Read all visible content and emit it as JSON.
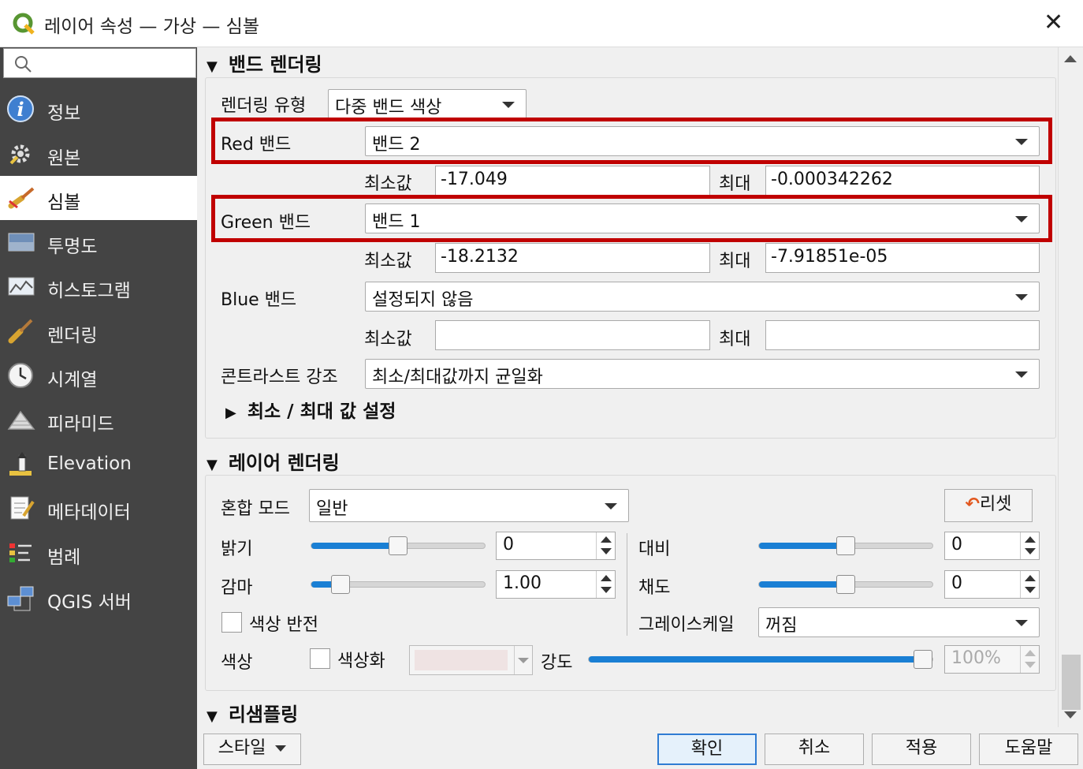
{
  "window": {
    "title": "레이어 속성 — 가상 — 심볼"
  },
  "sidebar": {
    "items": [
      {
        "label": "정보",
        "icon": "info-icon"
      },
      {
        "label": "원본",
        "icon": "source-gear-icon"
      },
      {
        "label": "심볼",
        "icon": "symbology-brush-icon",
        "selected": true
      },
      {
        "label": "투명도",
        "icon": "transparency-icon"
      },
      {
        "label": "히스토그램",
        "icon": "histogram-icon"
      },
      {
        "label": "렌더링",
        "icon": "rendering-brush-icon"
      },
      {
        "label": "시계열",
        "icon": "clock-icon"
      },
      {
        "label": "피라미드",
        "icon": "pyramid-icon"
      },
      {
        "label": "Elevation",
        "icon": "elevation-icon"
      },
      {
        "label": "메타데이터",
        "icon": "metadata-icon"
      },
      {
        "label": "범례",
        "icon": "legend-icon"
      },
      {
        "label": "QGIS 서버",
        "icon": "server-icon"
      }
    ]
  },
  "band": {
    "title": "밴드 렌더링",
    "render_type_label": "렌더링 유형",
    "render_type": "다중 밴드 색상",
    "red_label": "Red 밴드",
    "red_value": "밴드 2",
    "min_label": "최소값",
    "max_label": "최대",
    "red_min": "-17.049",
    "red_max": "-0.000342262",
    "green_label": "Green 밴드",
    "green_value": "밴드 1",
    "green_min": "-18.2132",
    "green_max": "-7.91851e-05",
    "blue_label": "Blue 밴드",
    "blue_value": "설정되지 않음",
    "blue_min": "",
    "blue_max": "",
    "contrast_label": "콘트라스트 강조",
    "contrast_value": "최소/최대값까지 균일화",
    "minmax_title": "최소 / 최대 값 설정"
  },
  "layer": {
    "title": "레이어 렌더링",
    "blend_label": "혼합 모드",
    "blend_value": "일반",
    "reset_label": "리셋",
    "brightness_label": "밝기",
    "brightness_value": "0",
    "brightness_level": 0.5,
    "contrast_label": "대비",
    "contrast_value": "0",
    "contrast_level": 0.5,
    "gamma_label": "감마",
    "gamma_value": "1.00",
    "gamma_level": 0.13,
    "saturation_label": "채도",
    "saturation_value": "0",
    "saturation_level": 0.5,
    "invert_label": "색상 반전",
    "grayscale_label": "그레이스케일",
    "grayscale_value": "꺼짐",
    "color_label": "색상",
    "colorize_label": "색상화",
    "colorize_swatch": "#efe3e3",
    "strength_label": "강도",
    "strength_value": "100%",
    "strength_level": 1.0
  },
  "resample": {
    "title": "리샘플링"
  },
  "footer": {
    "style": "스타일",
    "ok": "확인",
    "cancel": "취소",
    "apply": "적용",
    "help": "도움말"
  },
  "colors": {
    "highlight": "#c00000",
    "accent": "#1a7fd4",
    "sidebar_bg": "#444444",
    "qgis_green": "#589632"
  }
}
